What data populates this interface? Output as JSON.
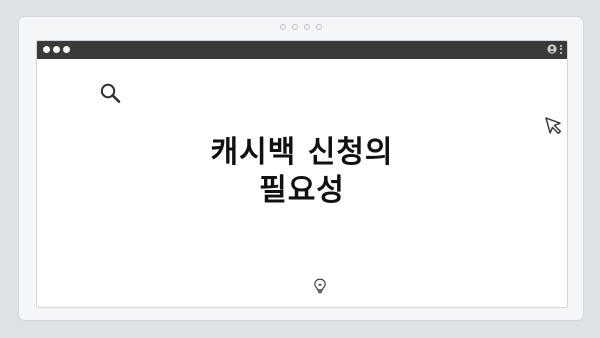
{
  "pager": {
    "dots": 4
  },
  "window": {
    "traffic_lights": 3
  },
  "headline": {
    "line1": "캐시백 신청의",
    "line2": "필요성"
  },
  "icons": {
    "search": "search-icon",
    "cursor": "cursor-icon",
    "bulb": "lightbulb-icon",
    "account": "account-icon",
    "menu": "kebab-menu-icon"
  }
}
